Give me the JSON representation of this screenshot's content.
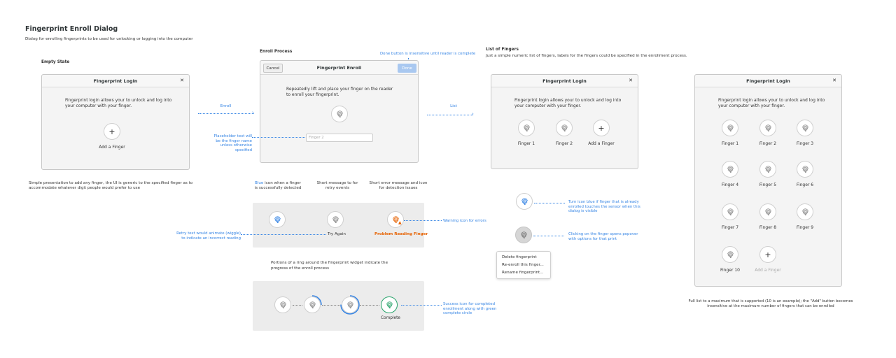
{
  "header": {
    "title": "Fingerprint Enroll Dialog",
    "subtitle": "Dialog for enrolling fingerprints to be used for unlocking or logging into the computer"
  },
  "empty_state": {
    "label": "Empty State",
    "window_title": "Fingerprint Login",
    "body": "Fingerprint login allows your to unlock and log into your computer with your finger.",
    "add_label": "Add a Finger",
    "caption": "Simple presentation to add any finger, the UI is generic to the specified finger as to accommodate whatever digit people would prefer to use"
  },
  "arrows": {
    "enroll": "Enroll",
    "list": "List"
  },
  "enroll": {
    "label": "Enroll Process",
    "note_done": "Done button is insensitive until reader is complete",
    "cancel": "Cancel",
    "window_title": "Fingerprint Enroll",
    "done": "Done",
    "body": "Repeatedly lift and place your finger on the reader to enroll your fingerprint.",
    "input_placeholder": "Finger 2",
    "placeholder_note": "Placeholder text will be the finger name unless otherwise specified",
    "states_caption_1_blue": "Blue",
    "states_caption_1_rest": " icon when a finger is successfully detected",
    "states_caption_2": "Short message to for retry events",
    "states_caption_3": "Short error message and icon for detection issues",
    "try_again": "Try Again",
    "problem": "Problem Reading Finger",
    "retry_note": "Retry text would animate (wiggle) to indicate an incorrect reading",
    "warning_note": "Warning icon for errors",
    "ring_caption": "Portions of a ring around the fingerprint widget indicate the progress of the enroll process",
    "complete": "Complete",
    "success_note": "Success icon for completed enrollment along with green complete circle"
  },
  "list": {
    "label": "List of Fingers",
    "desc": "Just a simple numeric list of fingers, labels for the fingers could be specified in the enrollment process.",
    "window_title": "Fingerprint Login",
    "body": "Fingerprint login allows your to unlock and log into your computer with your finger.",
    "fingers": [
      "Finger 1",
      "Finger 2"
    ],
    "add_label": "Add a Finger",
    "blue_note": "Turn icon blue if finger that is already enrolled touches the sensor when this dialog is visible",
    "click_note": "Clicking on the finger opens popover with options for that print",
    "popover": [
      "Delete fingerprint",
      "Re-enroll this finger...",
      "Rename fingerprint..."
    ]
  },
  "full_list": {
    "window_title": "Fingerprint Login",
    "body": "Fingerprint login allows your to unlock and log into your computer with your finger.",
    "fingers": [
      "Finger 1",
      "Finger 2",
      "Finger 3",
      "Finger 4",
      "Finger 5",
      "Finger 6",
      "Finger 7",
      "Finger 8",
      "Finger 9",
      "Finger 10"
    ],
    "add_label": "Add a Finger",
    "caption": "Full list to a maximum that is supported (10 is an example); the \"Add\" button becomes insensitive at the maximum number of fingers that can be enrolled"
  },
  "colors": {
    "accent": "#3584e4",
    "success": "#26a269",
    "warning": "#e66100",
    "window_bg": "#f4f4f4"
  },
  "icons": {
    "fingerprint": "fingerprint-icon",
    "add": "plus-icon",
    "close": "close-icon",
    "warning": "warning-icon"
  }
}
